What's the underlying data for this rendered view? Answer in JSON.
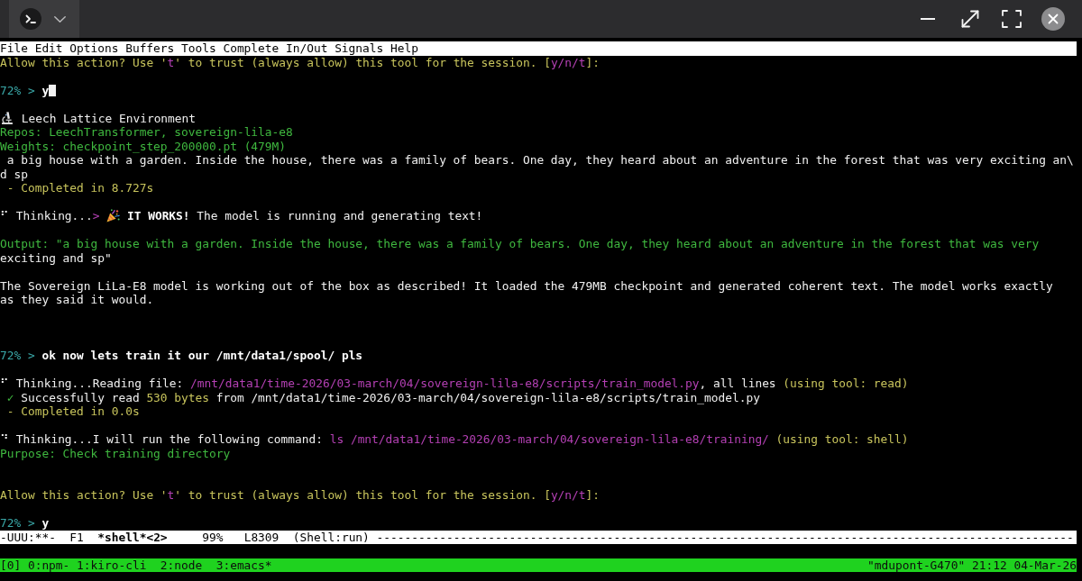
{
  "menu_bar": {
    "items": [
      "File",
      "Edit",
      "Options",
      "Buffers",
      "Tools",
      "Complete",
      "In/Out",
      "Signals",
      "Help"
    ]
  },
  "terminal": {
    "lines": [
      {
        "kind": "text",
        "spans": [
          {
            "kind": "notice",
            "text": "Allow this action? Use '"
          },
          {
            "kind": "path",
            "text": "t"
          },
          {
            "kind": "notice",
            "text": "' to trust (always allow) this tool for the session. ["
          },
          {
            "kind": "path",
            "text": "y/n/t"
          },
          {
            "kind": "notice",
            "text": "]:"
          }
        ]
      },
      {
        "kind": "blank"
      },
      {
        "kind": "prompt",
        "cursor": true,
        "spans": [
          {
            "kind": "prompt",
            "text": "72% > "
          },
          {
            "kind": "input",
            "text": "y"
          }
        ]
      },
      {
        "kind": "blank"
      },
      {
        "kind": "banner",
        "spans": [
          {
            "kind": "plain",
            "text": "Leech Lattice Environment"
          }
        ]
      },
      {
        "kind": "text",
        "spans": [
          {
            "kind": "ok",
            "text": "Repos: LeechTransformer, sovereign-lila-e8"
          }
        ]
      },
      {
        "kind": "text",
        "spans": [
          {
            "kind": "ok",
            "text": "Weights: checkpoint_step_200000.pt (479M)"
          }
        ]
      },
      {
        "kind": "text",
        "spans": [
          {
            "kind": "plain",
            "text": " a big house with a garden. Inside the house, there was a family of bears. One day, they heard about an adventure in the forest that was very exciting an\\"
          }
        ]
      },
      {
        "kind": "text",
        "spans": [
          {
            "kind": "plain",
            "text": "d sp"
          }
        ]
      },
      {
        "kind": "text",
        "spans": [
          {
            "kind": "notice",
            "text": " - Completed in 8.727s"
          }
        ]
      },
      {
        "kind": "blank"
      },
      {
        "kind": "celebration",
        "spans": [
          {
            "kind": "plain",
            "text": "⠋ Thinking..."
          },
          {
            "kind": "path",
            "text": ">"
          }
        ],
        "after": [
          {
            "kind": "strong",
            "text": "IT WORKS!"
          },
          {
            "kind": "plain",
            "text": " The model is running and generating text!"
          }
        ]
      },
      {
        "kind": "blank"
      },
      {
        "kind": "text",
        "spans": [
          {
            "kind": "ok",
            "text": "Output: \"a big house with a garden. Inside the house, there was a family of bears. One day, they heard about an adventure in the forest that was very"
          }
        ]
      },
      {
        "kind": "text",
        "spans": [
          {
            "kind": "plain",
            "text": "exciting and sp\""
          }
        ]
      },
      {
        "kind": "blank"
      },
      {
        "kind": "text",
        "spans": [
          {
            "kind": "plain",
            "text": "The Sovereign LiLa-E8 model is working out of the box as described! It loaded the 479MB checkpoint and generated coherent text. The model works exactly"
          }
        ]
      },
      {
        "kind": "text",
        "spans": [
          {
            "kind": "plain",
            "text": "as they said it would."
          }
        ]
      },
      {
        "kind": "blank"
      },
      {
        "kind": "blank"
      },
      {
        "kind": "blank"
      },
      {
        "kind": "prompt",
        "cursor": false,
        "spans": [
          {
            "kind": "prompt",
            "text": "72% > "
          },
          {
            "kind": "input",
            "text": "ok now lets train it our /mnt/data1/spool/ pls"
          }
        ]
      },
      {
        "kind": "blank"
      },
      {
        "kind": "text",
        "spans": [
          {
            "kind": "plain",
            "text": "⠋ Thinking...Reading file: "
          },
          {
            "kind": "path",
            "text": "/mnt/data1/time-2026/03-march/04/sovereign-lila-e8/scripts/train_model.py"
          },
          {
            "kind": "plain",
            "text": ", all lines "
          },
          {
            "kind": "notice",
            "text": "(using tool: read)"
          }
        ]
      },
      {
        "kind": "text",
        "spans": [
          {
            "kind": "ok",
            "text": " ✓"
          },
          {
            "kind": "plain",
            "text": " Successfully read "
          },
          {
            "kind": "notice",
            "text": "530 bytes"
          },
          {
            "kind": "plain",
            "text": " from /mnt/data1/time-2026/03-march/04/sovereign-lila-e8/scripts/train_model.py"
          }
        ]
      },
      {
        "kind": "text",
        "spans": [
          {
            "kind": "notice",
            "text": " - Completed in 0.0s"
          }
        ]
      },
      {
        "kind": "blank"
      },
      {
        "kind": "text",
        "spans": [
          {
            "kind": "plain",
            "text": "⠙ Thinking...I will run the following command: "
          },
          {
            "kind": "path",
            "text": "ls /mnt/data1/time-2026/03-march/04/sovereign-lila-e8/training/"
          },
          {
            "kind": "notice",
            "text": " (using tool: shell)"
          }
        ]
      },
      {
        "kind": "text",
        "spans": [
          {
            "kind": "ok",
            "text": "Purpose: Check training directory"
          }
        ]
      },
      {
        "kind": "blank"
      },
      {
        "kind": "blank"
      },
      {
        "kind": "text",
        "spans": [
          {
            "kind": "notice",
            "text": "Allow this action? Use '"
          },
          {
            "kind": "path",
            "text": "t"
          },
          {
            "kind": "notice",
            "text": "' to trust (always allow) this tool for the session. ["
          },
          {
            "kind": "path",
            "text": "y/n/t"
          },
          {
            "kind": "notice",
            "text": "]:"
          }
        ]
      },
      {
        "kind": "blank"
      },
      {
        "kind": "prompt",
        "cursor": false,
        "spans": [
          {
            "kind": "prompt",
            "text": "72% > "
          },
          {
            "kind": "input",
            "text": "y"
          }
        ]
      }
    ]
  },
  "mode_line": {
    "segments": [
      {
        "kind": "plain",
        "text": "-UUU:**-  F1  "
      },
      {
        "kind": "strong",
        "text": "*shell*<2>"
      },
      {
        "kind": "plain",
        "text": "     99%   L8309  (Shell:run) ----------------------------------------------------------------------------------------------------"
      }
    ]
  },
  "status_bar": {
    "session": "[0]",
    "windows": [
      "0:npm-",
      "1:kiro-cli",
      "2:node",
      "3:emacs*"
    ],
    "host_info": "\"mdupont-G470\" 21:12 04-Mar-26"
  }
}
